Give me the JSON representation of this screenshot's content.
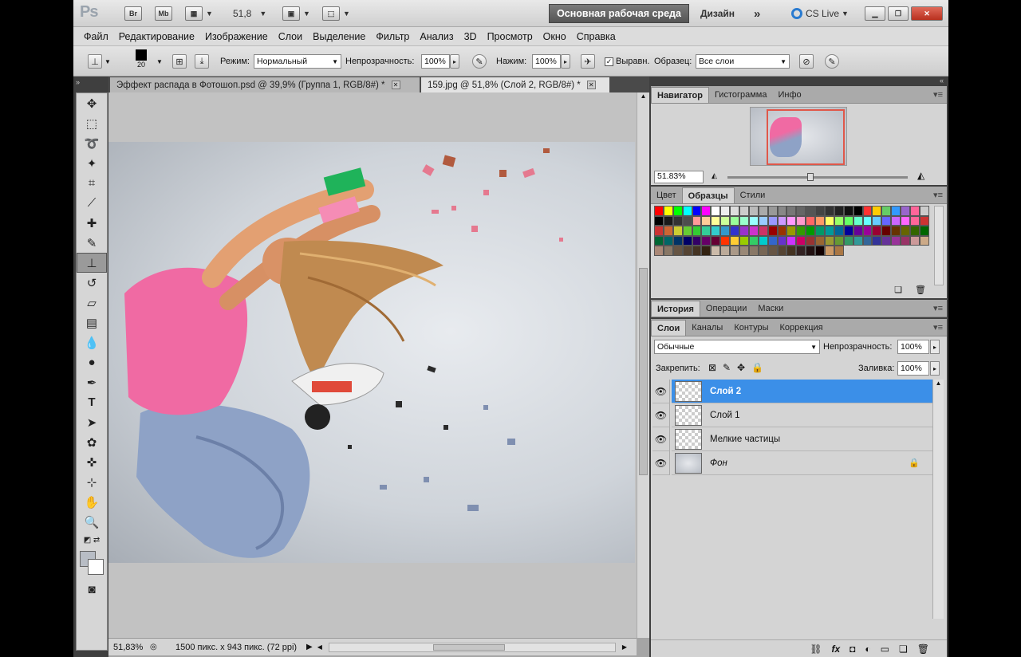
{
  "app": {
    "logo": "Ps",
    "bridge": "Br",
    "minibridge": "Mb",
    "zoom": "51,8"
  },
  "workspace": {
    "active": "Основная рабочая среда",
    "design": "Дизайн",
    "more": "»",
    "cslive": "CS Live"
  },
  "menu": [
    "Файл",
    "Редактирование",
    "Изображение",
    "Слои",
    "Выделение",
    "Фильтр",
    "Анализ",
    "3D",
    "Просмотр",
    "Окно",
    "Справка"
  ],
  "options": {
    "brush_size": "20",
    "mode_label": "Режим:",
    "mode_value": "Нормальный",
    "opacity_label": "Непрозрачность:",
    "opacity_value": "100%",
    "flow_label": "Нажим:",
    "flow_value": "100%",
    "aligned_label": "Выравн.",
    "sample_label": "Образец:",
    "sample_value": "Все слои"
  },
  "tabs": [
    {
      "label": "Эффект распада в Фотошоп.psd @ 39,9% (Группа 1, RGB/8#) *"
    },
    {
      "label": "159.jpg @ 51,8% (Слой 2, RGB/8#) *"
    }
  ],
  "status": {
    "zoom": "51,83%",
    "info": "1500 пикс. x 943 пикс. (72 ppi)"
  },
  "navigator": {
    "tabs": [
      "Навигатор",
      "Гистограмма",
      "Инфо"
    ],
    "zoom": "51.83%"
  },
  "swatches_panel": {
    "tabs": [
      "Цвет",
      "Образцы",
      "Стили"
    ]
  },
  "history_panel": {
    "tabs": [
      "История",
      "Операции",
      "Маски"
    ]
  },
  "layers_panel": {
    "tabs": [
      "Слои",
      "Каналы",
      "Контуры",
      "Коррекция"
    ],
    "blend": "Обычные",
    "opacity_label": "Непрозрачность:",
    "opacity": "100%",
    "lock_label": "Закрепить:",
    "fill_label": "Заливка:",
    "fill": "100%",
    "layers": [
      {
        "name": "Слой 2",
        "selected": true
      },
      {
        "name": "Слой 1",
        "selected": false
      },
      {
        "name": "Мелкие частицы",
        "selected": false
      },
      {
        "name": "Фон",
        "selected": false,
        "locked": true
      }
    ]
  },
  "colors": {
    "selection": "#3b8fe8",
    "workspace_button": "#5f5f5f"
  }
}
